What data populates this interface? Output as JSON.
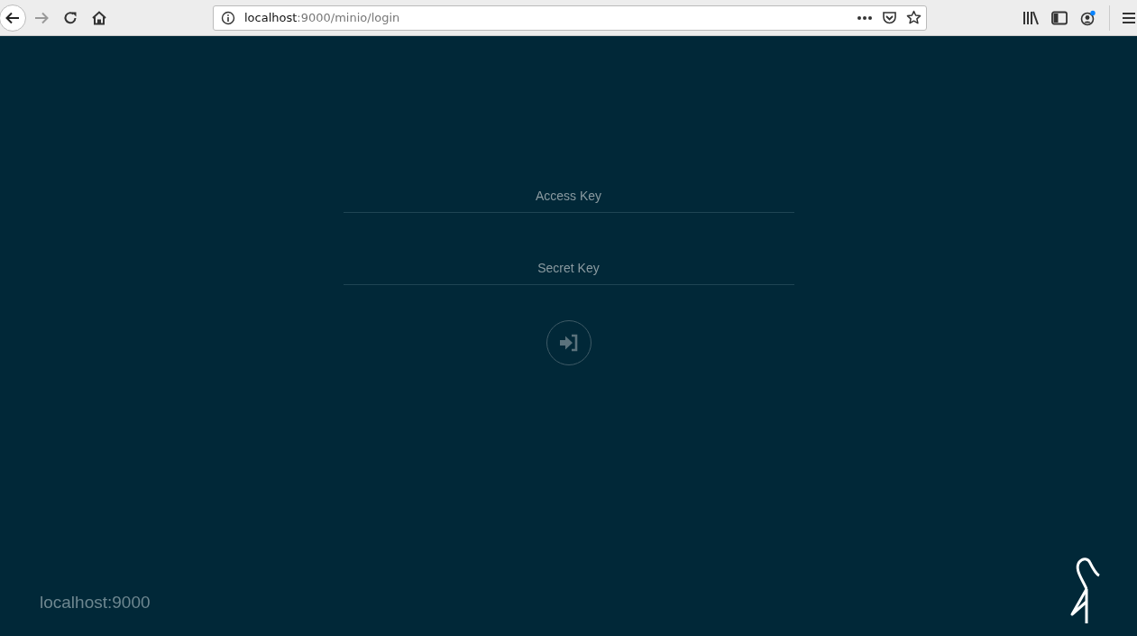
{
  "browser": {
    "url_host": "localhost",
    "url_path": ":9000/minio/login"
  },
  "login": {
    "fields": [
      {
        "placeholder": "Access Key"
      },
      {
        "placeholder": "Secret Key"
      }
    ]
  },
  "footer": {
    "host": "localhost:9000"
  }
}
